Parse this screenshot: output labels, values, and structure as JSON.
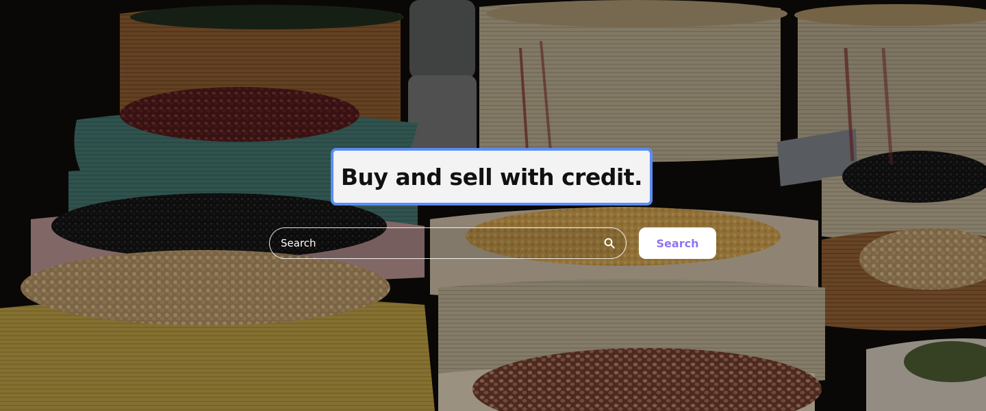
{
  "hero": {
    "headline": "Buy and sell with credit.",
    "background": {
      "image": "market sacks of grains and beans",
      "dark_overlay": true
    }
  },
  "search": {
    "placeholder": "Search",
    "icon": "search-icon",
    "button_label": "Search"
  },
  "colors": {
    "accent_border": "#5b8df6",
    "button_text": "#8f73f1",
    "button_bg": "#ffffff",
    "headline_bg": "#f3f3f3"
  }
}
